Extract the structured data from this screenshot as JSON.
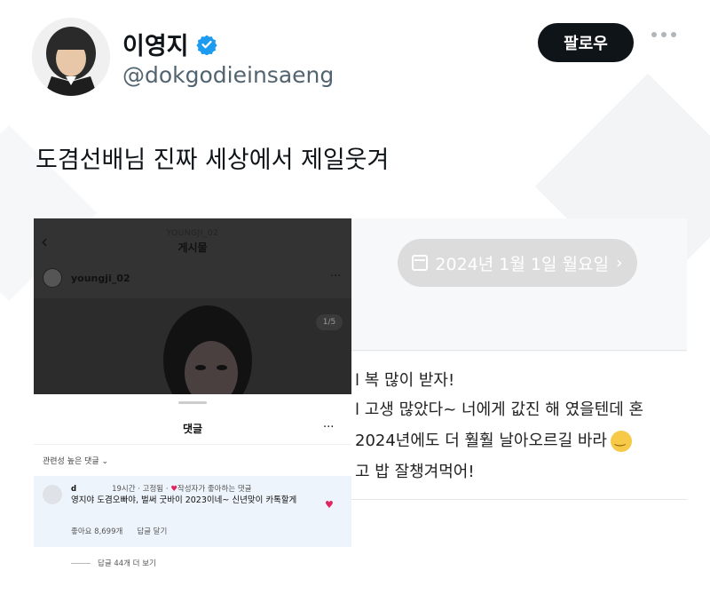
{
  "author": {
    "display_name": "이영지",
    "handle": "@dokgodieinsaeng",
    "verified_icon": "verified-badge-icon"
  },
  "actions": {
    "follow_label": "팔로우"
  },
  "tweet": {
    "text": "도겸선배님 진짜 세상에서 제일웃겨"
  },
  "instagram": {
    "account_small": "YOUNGJI_02",
    "page_title": "게시물",
    "post_username": "youngji_02",
    "photo_counter": "1/5",
    "comments_title": "댓글",
    "sort_label": "관련성 높은 댓글",
    "comment": {
      "user": "d",
      "time": "19시간",
      "pinned": "고정됨",
      "liked_by_author": "작성자가 좋아하는 댓글",
      "body": "영지야 도겸오빠야, 벌써 굿바이 2023이네~ 신년맞이 카톡할게",
      "likes": "좋아요 8,699개",
      "reply": "답글 달기"
    },
    "more_replies": "답글 44개 더 보기"
  },
  "diary": {
    "date": "2024년 1월 1일 월요일",
    "lines": [
      "l 복 많이 받자!",
      "l 고생 많았다~ 너에게 값진 해 였을텐데 혼",
      "2024년에도 더 훨훨 날아오르길 바라",
      "고 밥 잘챙겨먹어!"
    ]
  },
  "colors": {
    "follow_bg": "#0f1419",
    "verified": "#1d9bf0",
    "heart": "#e0245e",
    "date_pill": "#dcdcdc"
  }
}
